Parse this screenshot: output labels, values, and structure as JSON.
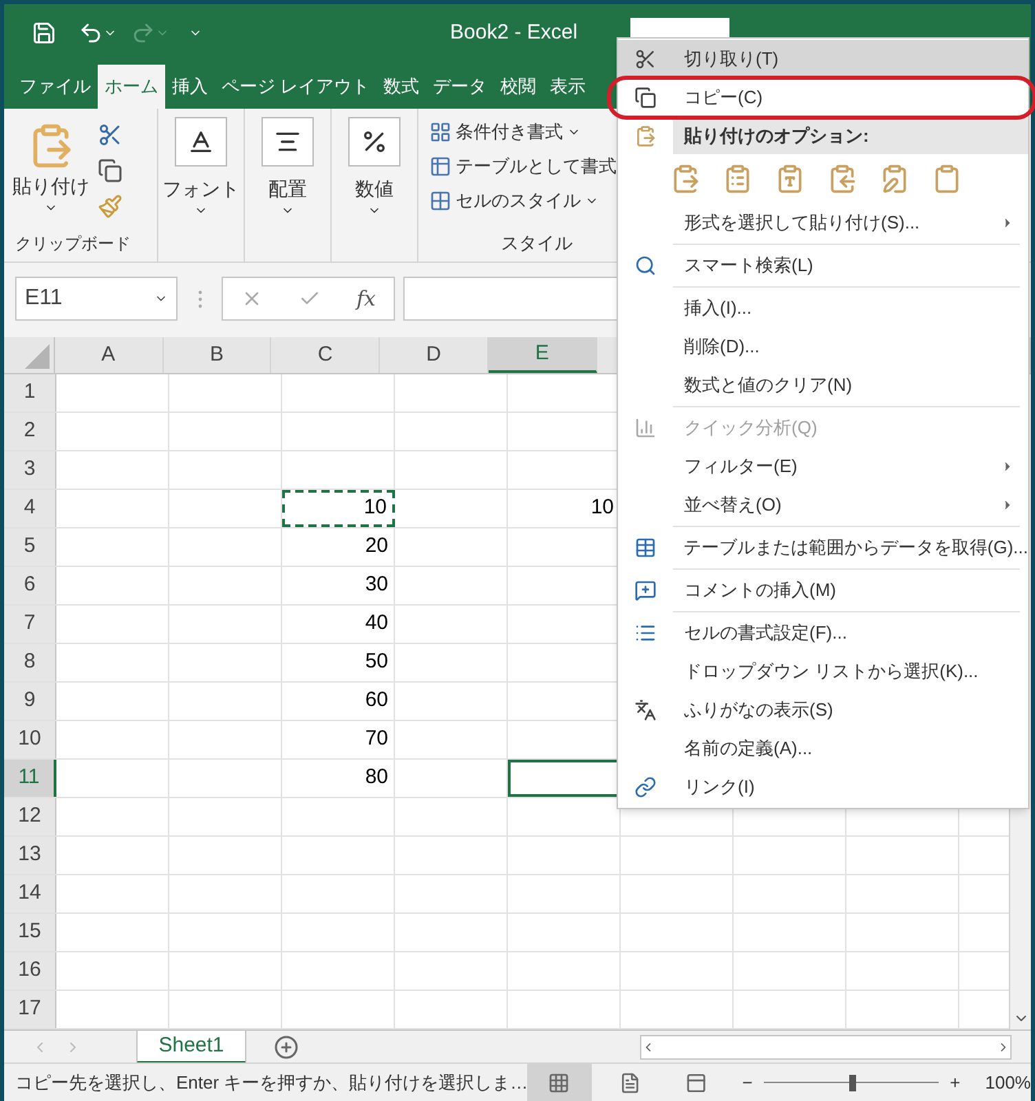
{
  "window": {
    "title": "Book2  -  Excel"
  },
  "tabs": [
    {
      "label": "ファイル",
      "selected": false
    },
    {
      "label": "ホーム",
      "selected": true
    },
    {
      "label": "挿入",
      "selected": false
    },
    {
      "label": "ページ レイアウト",
      "selected": false
    },
    {
      "label": "数式",
      "selected": false
    },
    {
      "label": "データ",
      "selected": false
    },
    {
      "label": "校閲",
      "selected": false
    },
    {
      "label": "表示",
      "selected": false
    }
  ],
  "ribbon": {
    "clipboard": {
      "paste": "貼り付け",
      "group_label": "クリップボード"
    },
    "font": {
      "label": "フォント"
    },
    "alignment": {
      "label": "配置"
    },
    "number": {
      "label": "数値"
    },
    "styles": {
      "items": [
        "条件付き書式",
        "テーブルとして書式",
        "セルのスタイル"
      ],
      "group_label": "スタイル"
    }
  },
  "formula_bar": {
    "name_box": "E11",
    "fx": "fx"
  },
  "columns": [
    {
      "label": "A",
      "selected": false
    },
    {
      "label": "B",
      "selected": false
    },
    {
      "label": "C",
      "selected": false
    },
    {
      "label": "D",
      "selected": false
    },
    {
      "label": "E",
      "selected": true
    }
  ],
  "rows": [
    {
      "label": "1",
      "selected": false,
      "cells": {}
    },
    {
      "label": "2",
      "selected": false,
      "cells": {}
    },
    {
      "label": "3",
      "selected": false,
      "cells": {}
    },
    {
      "label": "4",
      "selected": false,
      "cells": {
        "C": {
          "value": "10",
          "copied": true
        },
        "E": {
          "value": "10"
        }
      }
    },
    {
      "label": "5",
      "selected": false,
      "cells": {
        "C": {
          "value": "20"
        }
      }
    },
    {
      "label": "6",
      "selected": false,
      "cells": {
        "C": {
          "value": "30"
        }
      }
    },
    {
      "label": "7",
      "selected": false,
      "cells": {
        "C": {
          "value": "40"
        }
      }
    },
    {
      "label": "8",
      "selected": false,
      "cells": {
        "C": {
          "value": "50"
        }
      }
    },
    {
      "label": "9",
      "selected": false,
      "cells": {
        "C": {
          "value": "60"
        }
      }
    },
    {
      "label": "10",
      "selected": false,
      "cells": {
        "C": {
          "value": "70"
        }
      }
    },
    {
      "label": "11",
      "selected": true,
      "cells": {
        "C": {
          "value": "80"
        },
        "E": {
          "active": true
        }
      }
    },
    {
      "label": "12",
      "selected": false,
      "cells": {}
    },
    {
      "label": "13",
      "selected": false,
      "cells": {}
    },
    {
      "label": "14",
      "selected": false,
      "cells": {}
    },
    {
      "label": "15",
      "selected": false,
      "cells": {}
    },
    {
      "label": "16",
      "selected": false,
      "cells": {}
    },
    {
      "label": "17",
      "selected": false,
      "cells": {}
    }
  ],
  "sheet_tabs": [
    {
      "label": "Sheet1",
      "selected": true
    }
  ],
  "context_menu": [
    {
      "kind": "item",
      "label": "切り取り(T)",
      "selected": true,
      "disabled": false,
      "submenu": false,
      "circled": false
    },
    {
      "kind": "item",
      "label": "コピー(C)",
      "selected": false,
      "disabled": false,
      "submenu": false,
      "circled": true
    },
    {
      "kind": "header",
      "label": "貼り付けのオプション:"
    },
    {
      "kind": "paste-options"
    },
    {
      "kind": "item",
      "label": "形式を選択して貼り付け(S)...",
      "selected": false,
      "disabled": false,
      "submenu": true,
      "circled": false
    },
    {
      "kind": "separator"
    },
    {
      "kind": "item",
      "label": "スマート検索(L)",
      "selected": false,
      "disabled": false,
      "submenu": false,
      "circled": false
    },
    {
      "kind": "separator"
    },
    {
      "kind": "item",
      "label": "挿入(I)...",
      "selected": false,
      "disabled": false,
      "submenu": false,
      "circled": false
    },
    {
      "kind": "item",
      "label": "削除(D)...",
      "selected": false,
      "disabled": false,
      "submenu": false,
      "circled": false
    },
    {
      "kind": "item",
      "label": "数式と値のクリア(N)",
      "selected": false,
      "disabled": false,
      "submenu": false,
      "circled": false
    },
    {
      "kind": "separator"
    },
    {
      "kind": "item",
      "label": "クイック分析(Q)",
      "selected": false,
      "disabled": true,
      "submenu": false,
      "circled": false
    },
    {
      "kind": "item",
      "label": "フィルター(E)",
      "selected": false,
      "disabled": false,
      "submenu": true,
      "circled": false
    },
    {
      "kind": "item",
      "label": "並べ替え(O)",
      "selected": false,
      "disabled": false,
      "submenu": true,
      "circled": false
    },
    {
      "kind": "separator"
    },
    {
      "kind": "item",
      "label": "テーブルまたは範囲からデータを取得(G)...",
      "selected": false,
      "disabled": false,
      "submenu": false,
      "circled": false
    },
    {
      "kind": "separator"
    },
    {
      "kind": "item",
      "label": "コメントの挿入(M)",
      "selected": false,
      "disabled": false,
      "submenu": false,
      "circled": false
    },
    {
      "kind": "separator"
    },
    {
      "kind": "item",
      "label": "セルの書式設定(F)...",
      "selected": false,
      "disabled": false,
      "submenu": false,
      "circled": false
    },
    {
      "kind": "item",
      "label": "ドロップダウン リストから選択(K)...",
      "selected": false,
      "disabled": false,
      "submenu": false,
      "circled": false
    },
    {
      "kind": "item",
      "label": "ふりがなの表示(S)",
      "selected": false,
      "disabled": false,
      "submenu": false,
      "circled": false
    },
    {
      "kind": "item",
      "label": "名前の定義(A)...",
      "selected": false,
      "disabled": false,
      "submenu": false,
      "circled": false
    },
    {
      "kind": "item",
      "label": "リンク(I)",
      "selected": false,
      "disabled": false,
      "submenu": false,
      "circled": false
    }
  ],
  "status_bar": {
    "message": "コピー先を選択し、Enter キーを押すか、貼り付けを選択しま…",
    "zoom_minus": "−",
    "zoom_plus": "+",
    "zoom": {
      "level": 0.5
    },
    "zoom_label": "100%"
  }
}
